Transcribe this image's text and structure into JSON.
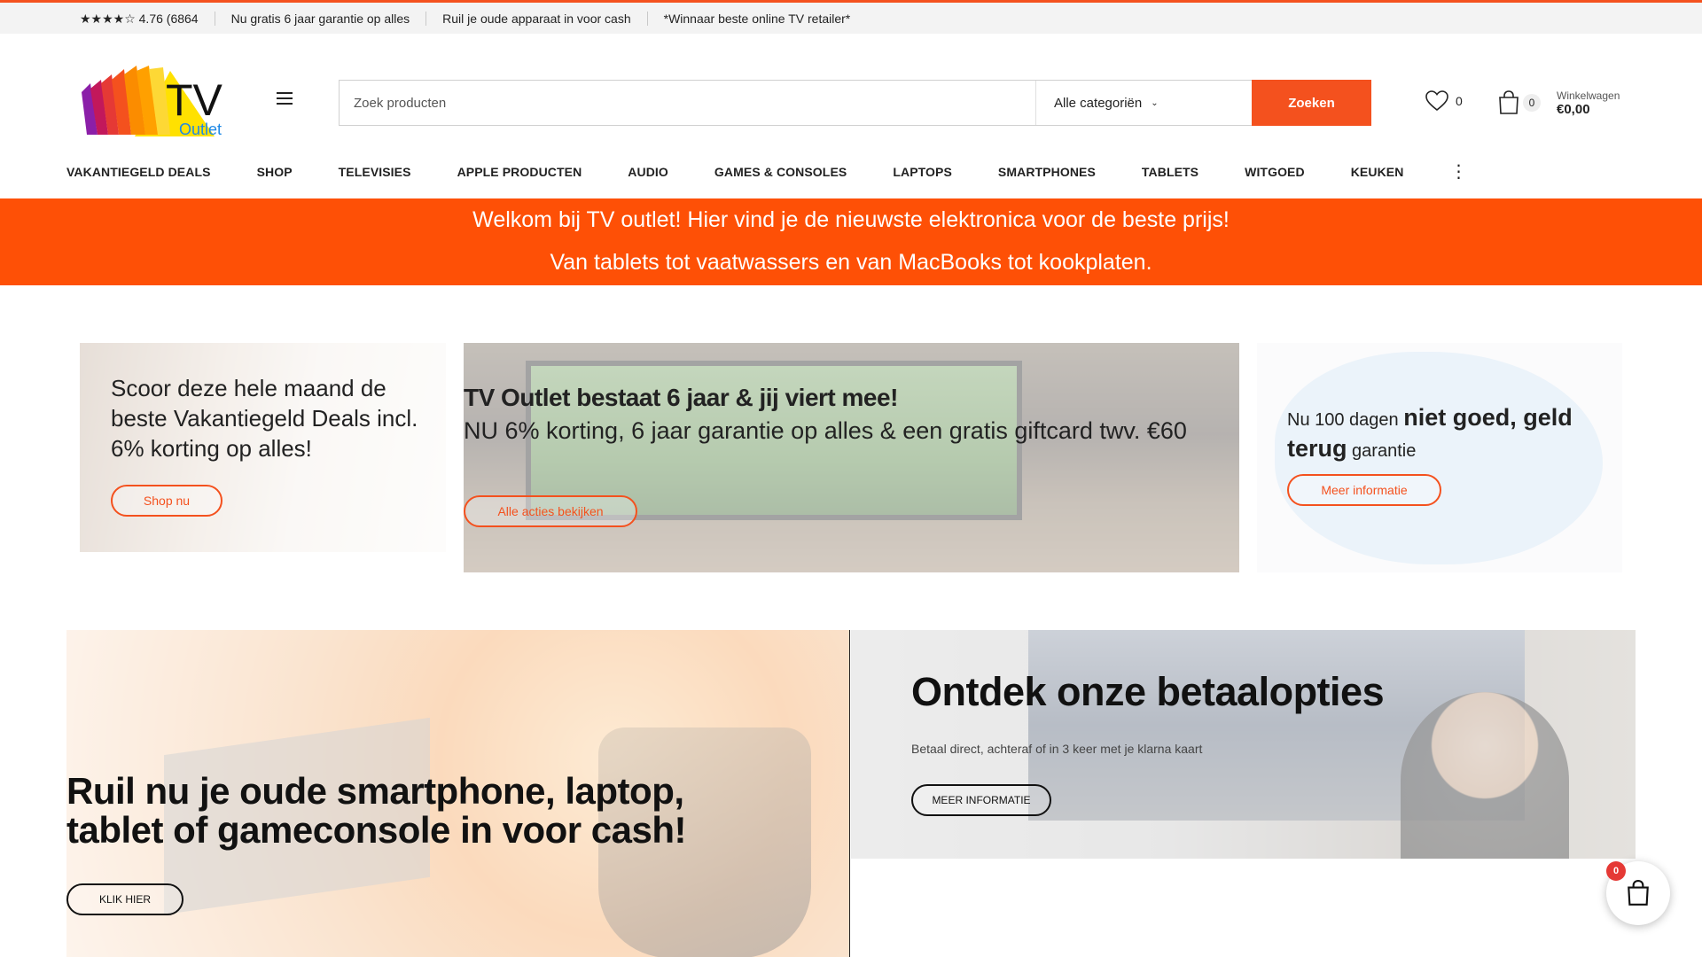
{
  "topbar": {
    "rating": "★★★★☆ 4.76 (6864",
    "guarantee": "Nu gratis 6 jaar garantie op alles",
    "tradein": "Ruil je oude apparaat in voor cash",
    "award": "*Winnaar beste online TV retailer*"
  },
  "logo": {
    "main": "TV",
    "sub": "Outlet"
  },
  "search": {
    "placeholder": "Zoek producten",
    "category": "Alle categoriën",
    "button": "Zoeken"
  },
  "wishlist": {
    "count": "0"
  },
  "cart": {
    "count": "0",
    "label": "Winkelwagen",
    "total": "€0,00"
  },
  "nav": [
    "VAKANTIEGELD DEALS",
    "SHOP",
    "TELEVISIES",
    "APPLE PRODUCTEN",
    "AUDIO",
    "GAMES & CONSOLES",
    "LAPTOPS",
    "SMARTPHONES",
    "TABLETS",
    "WITGOED",
    "KEUKEN"
  ],
  "banner": {
    "line1": "Welkom bij TV outlet! Hier vind je de nieuwste elektronica voor de beste prijs!",
    "line2": "Van tablets tot vaatwassers en van MacBooks tot kookplaten."
  },
  "promo1": {
    "text": "Scoor deze hele maand de beste Vakantiegeld Deals incl. 6% korting op alles!",
    "button": "Shop nu"
  },
  "promo2": {
    "heading": "TV Outlet bestaat 6 jaar & jij viert mee!",
    "text": "NU 6% korting, 6 jaar garantie op alles & een gratis giftcard twv. €60",
    "button": "Alle acties bekijken"
  },
  "promo3": {
    "pre": "Nu 100 dagen ",
    "bold": "niet goed, geld terug",
    "post": " garantie",
    "button": "Meer informatie"
  },
  "tradein_card": {
    "heading": "Ruil nu je oude smartphone, laptop, tablet of gameconsole in voor cash!",
    "button": "KLIK HIER"
  },
  "payment_card": {
    "heading": "Ontdek onze betaalopties",
    "text": "Betaal direct, achteraf of in 3 keer met je klarna kaart",
    "button": "MEER INFORMATIE"
  },
  "floating_cart": {
    "count": "0"
  },
  "colors": {
    "accent": "#f4511e",
    "banner": "#fe5006"
  }
}
